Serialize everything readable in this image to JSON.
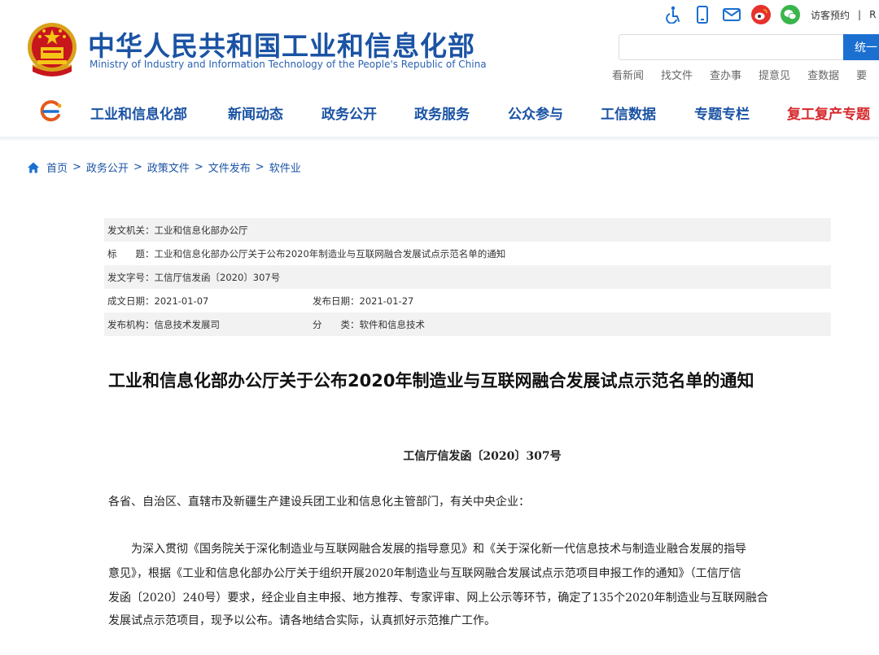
{
  "header": {
    "brand_cn": "中华人民共和国工业和信息化部",
    "brand_en": "Ministry of Industry and Information Technology of the People's Republic of China",
    "emblem_icon": "national-emblem-icon",
    "top_icons": [
      "accessibility-icon",
      "mobile-icon",
      "mail-icon",
      "weibo-icon",
      "wechat-icon"
    ],
    "visitor_label": "访客预约",
    "separator": "|",
    "rss_label": "R",
    "search": {
      "value": "",
      "placeholder": "",
      "button_label": "统一"
    },
    "quick_links": [
      "看新闻",
      "找文件",
      "查办事",
      "提意见",
      "查数据",
      "要"
    ],
    "colors": {
      "brand_blue": "#1b53a4",
      "search_blue": "#1b6fd0",
      "special_red": "#d6282d"
    }
  },
  "nav": {
    "logo_icon": "miit-logo-icon",
    "items": [
      "工业和信息化部",
      "新闻动态",
      "政务公开",
      "政务服务",
      "公众参与",
      "工信数据",
      "专题专栏",
      "复工复产专题"
    ]
  },
  "breadcrumb": {
    "home_icon": "home-icon",
    "items": [
      "首页",
      "政务公开",
      "政策文件",
      "文件发布",
      "软件业"
    ],
    "separator": ">"
  },
  "meta": {
    "issuer": "发文机关：工业和信息化部办公厅",
    "title": "标　　题：工业和信息化部办公厅关于公布2020年制造业与互联网融合发展试点示范名单的通知",
    "doc_no": "发文字号：工信厅信发函〔2020〕307号",
    "written_date": "成文日期：2021-01-07",
    "publish_date": "发布日期：2021-01-27",
    "agency": "发布机构：信息技术发展司",
    "category": "分　　类：软件和信息技术"
  },
  "article": {
    "title": "工业和信息化部办公厅关于公布2020年制造业与互联网融合发展试点示范名单的通知",
    "doc_number": "工信厅信发函〔2020〕307号",
    "greeting": "各省、自治区、直辖市及新疆生产建设兵团工业和信息化主管部门，有关中央企业：",
    "lines": [
      "　　为深入贯彻《国务院关于深化制造业与互联网融合发展的指导意见》和《关于深化新一代信息技术与制造业融合发展的指导",
      "意见》，根据《工业和信息化部办公厅关于组织开展2020年制造业与互联网融合发展试点示范项目申报工作的通知》（工信厅信",
      "发函〔2020〕240号）要求，经企业自主申报、地方推荐、专家评审、网上公示等环节，确定了135个2020年制造业与互联网融合",
      "发展试点示范项目，现予以公布。请各地结合实际，认真抓好示范推广工作。"
    ]
  }
}
